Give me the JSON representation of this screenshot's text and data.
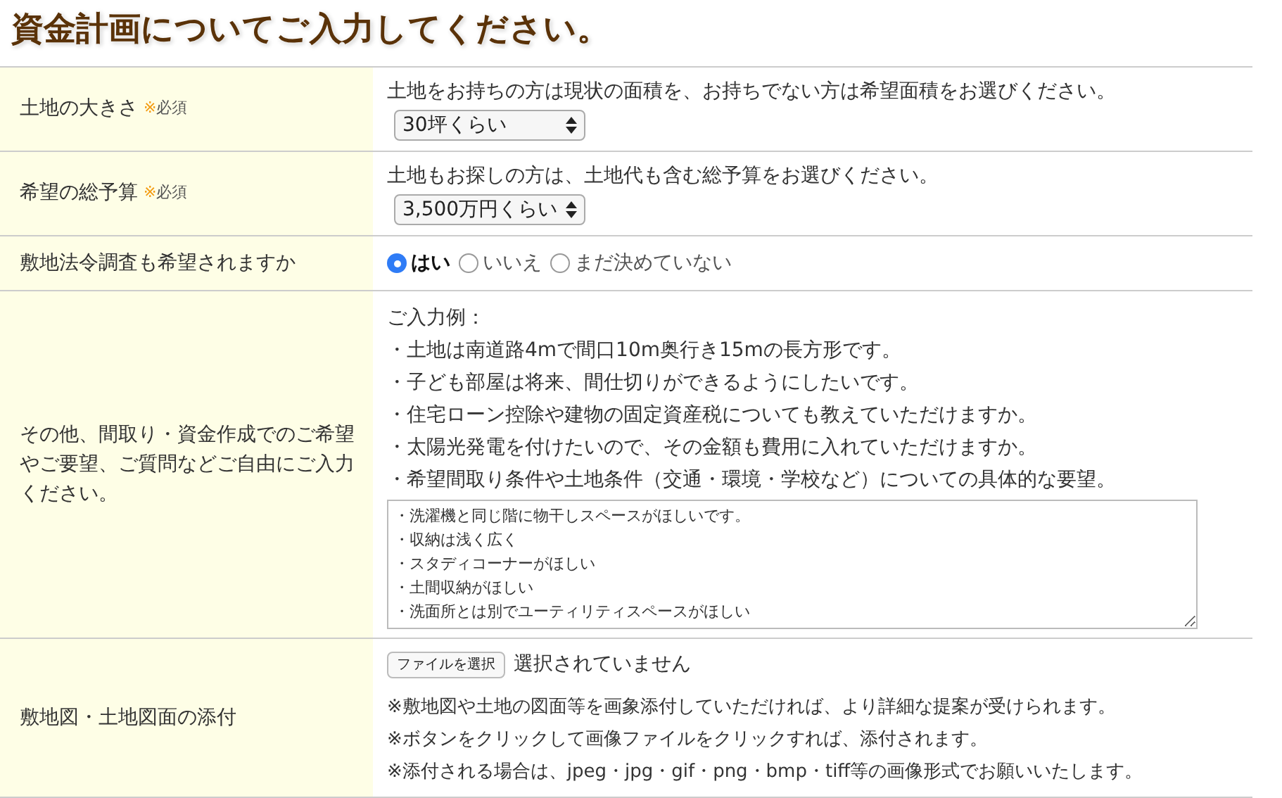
{
  "title": "資金計画についてご入力してください。",
  "rows": [
    {
      "kind": "select",
      "label": "土地の大きさ",
      "required_mark": "※",
      "required_label": "必須",
      "hint": "土地をお持ちの方は現状の面積を、お持ちでない方は希望面積をお選びください。",
      "value": "30坪くらい"
    },
    {
      "kind": "select",
      "label": "希望の総予算",
      "required_mark": "※",
      "required_label": "必須",
      "hint": "土地もお探しの方は、土地代も含む総予算をお選びください。",
      "value": "3,500万円くらい"
    },
    {
      "kind": "radio",
      "label": "敷地法令調査も希望されますか",
      "options": [
        {
          "label": "はい",
          "selected": true
        },
        {
          "label": "いいえ",
          "selected": false
        },
        {
          "label": "まだ決めていない",
          "selected": false
        }
      ]
    },
    {
      "kind": "textarea",
      "label": "その他、間取り・資金作成でのご希望やご要望、ご質問などご自由にご入力ください。",
      "examples": [
        "ご入力例：",
        "・土地は南道路4mで間口10m奥行き15mの長方形です。",
        "・子ども部屋は将来、間仕切りができるようにしたいです。",
        "・住宅ローン控除や建物の固定資産税についても教えていただけますか。",
        "・太陽光発電を付けたいので、その金額も費用に入れていただけますか。",
        "・希望間取り条件や土地条件（交通・環境・学校など）についての具体的な要望。"
      ],
      "value": [
        "・洗濯機と同じ階に物干しスペースがほしいです。",
        "・収納は浅く広く",
        "・スタディコーナーがほしい",
        "・土間収納がほしい",
        "・洗面所とは別でユーティリティスペースがほしい"
      ]
    },
    {
      "kind": "file",
      "label": "敷地図・土地図面の添付",
      "button": "ファイルを選択",
      "status": "選択されていません",
      "notes": [
        "※敷地図や土地の図面等を画象添付していただければ、より詳細な提案が受けられます。",
        "※ボタンをクリックして画像ファイルをクリックすれば、添付されます。",
        "※添付される場合は、jpeg・jpg・gif・png・bmp・tiff等の画像形式でお願いいたします。"
      ]
    }
  ]
}
